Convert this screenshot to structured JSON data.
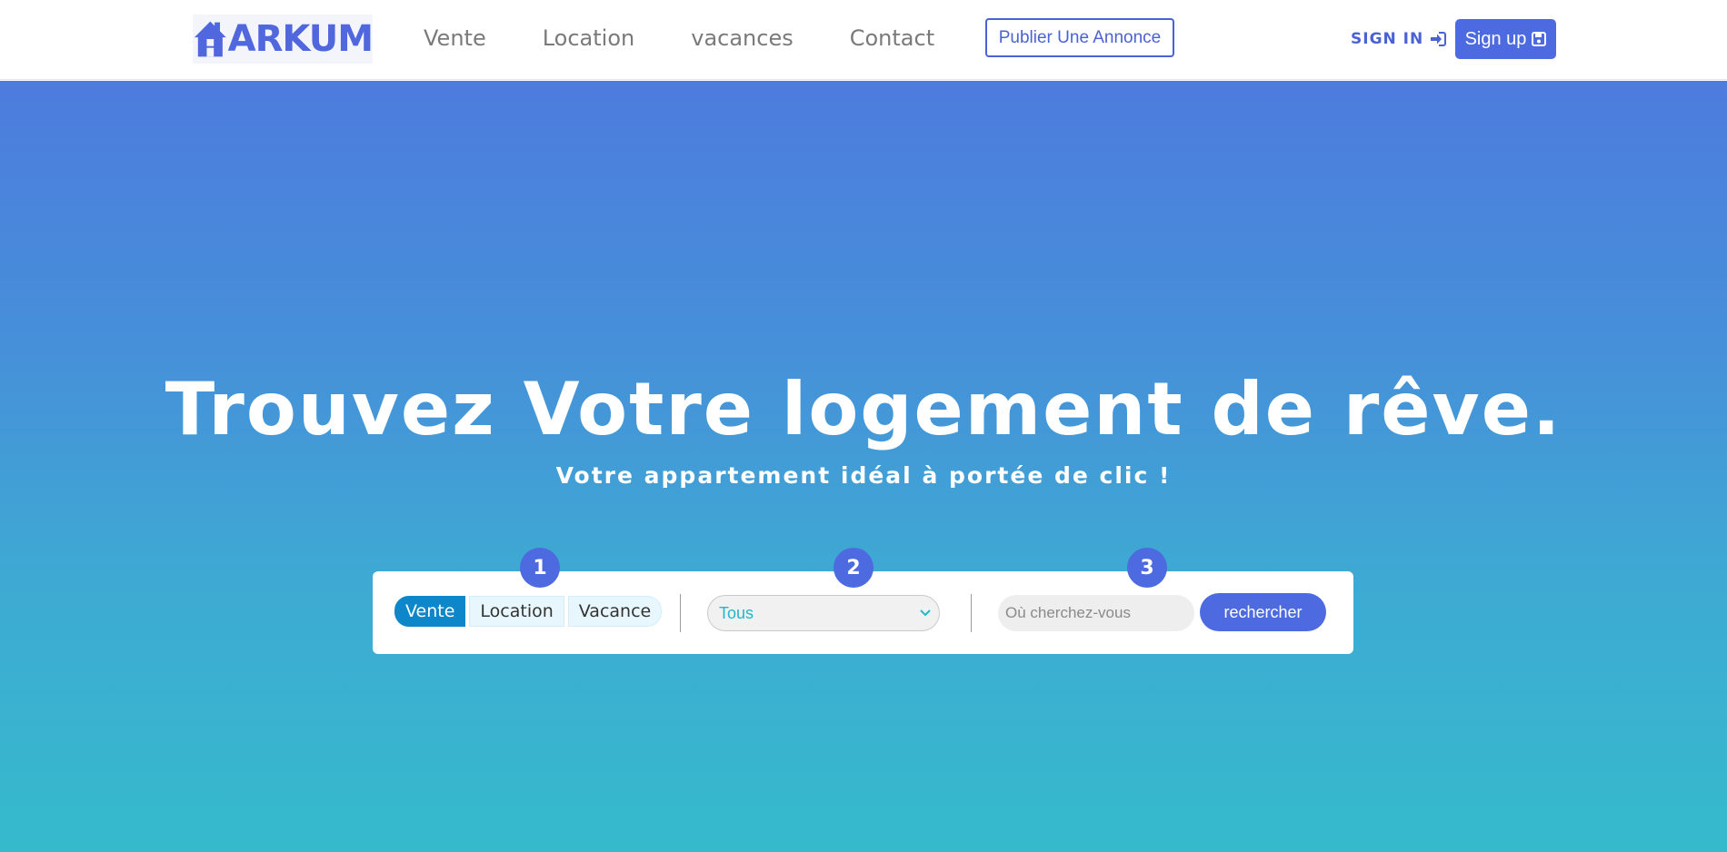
{
  "brand": {
    "logo_text": "ARKUM",
    "color": "#5067dd"
  },
  "nav": {
    "links": [
      "Vente",
      "Location",
      "vacances",
      "Contact"
    ],
    "publish_label": "Publier Une Annonce",
    "signin_label": "SIGN IN",
    "signup_label": "Sign up"
  },
  "hero": {
    "title": "Trouvez Votre logement de rêve.",
    "subtitle": "Votre appartement idéal à portée de clic !",
    "gradient_top": "#4d7cde",
    "gradient_bottom": "#35bacc"
  },
  "search": {
    "steps": [
      "1",
      "2",
      "3"
    ],
    "types": [
      "Vente",
      "Location",
      "Vacance"
    ],
    "active_type": "Vente",
    "category_value": "Tous",
    "location_placeholder": "Où cherchez-vous",
    "submit_label": "rechercher"
  },
  "icons": {
    "logo": "house-icon",
    "signin": "sign-in-icon",
    "signup": "save-icon",
    "select": "chevron-down-icon"
  },
  "colors": {
    "accent": "#4e6ae0",
    "active_tab": "#0d87c9",
    "select_text": "#21b6c9"
  }
}
